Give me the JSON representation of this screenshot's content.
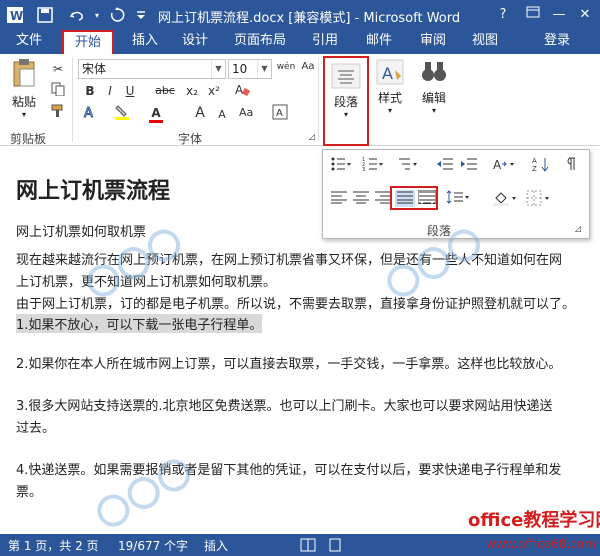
{
  "titlebar": {
    "title": "网上订机票流程.docx [兼容模式] - Microsoft Word",
    "help": "?",
    "minimize": "—",
    "maximize": "□",
    "close": "✕"
  },
  "quick_access": {
    "save": "save-icon",
    "undo": "undo-icon",
    "redo": "redo-icon",
    "customize": "customize-icon"
  },
  "tabs": [
    "文件",
    "开始",
    "插入",
    "设计",
    "页面布局",
    "引用",
    "邮件",
    "审阅",
    "视图"
  ],
  "login": "登录",
  "ribbon": {
    "clipboard": {
      "paste": "粘贴",
      "label": "剪贴板"
    },
    "font": {
      "name": "宋体",
      "size": "10",
      "label": "字体",
      "bold": "B",
      "italic": "I",
      "underline": "U",
      "strike": "abc",
      "sub": "x₂",
      "sup": "x²",
      "font_color": "A",
      "grow": "A",
      "shrink": "A",
      "wen": "wén",
      "aa": "Aa"
    },
    "paragraph": {
      "label": "段落"
    },
    "styles": {
      "label": "样式"
    },
    "editing": {
      "label": "编辑"
    }
  },
  "document": {
    "title": "网上订机票流程",
    "subtitle": "网上订机票如何取机票",
    "lines": [
      "现在越来越流行在网上预订机票，在网上预订机票省事又环保，但是还有一些人不知道如何在网",
      "上订机票，更不知道网上订机票如何取机票。",
      "由于网上订机票，订的都是电子机票。所以说，不需要去取票，直接拿身份证护照登机就可以了。",
      "1.如果不放心，可以下载一张电子行程单。",
      "2.如果你在本人所在城市网上订票，可以直接去取票，一手交钱，一手拿票。这样也比较放心。",
      "3.很多大网站支持送票的.北京地区免费送票。也可以上门刷卡。大家也可以要求网站用快递送",
      "过去。",
      "4.快递送票。如果需要报销或者是留下其他的凭证，可以在支付以后，要求快递电子行程单和发",
      "票。"
    ]
  },
  "popup": {
    "label": "段落"
  },
  "status": {
    "page": "第 1 页，共 2 页",
    "words": "19/677 个字",
    "mode": "插入"
  },
  "brand": {
    "text": "office教程学习网",
    "url": "www.office68.com"
  },
  "colors": {
    "accent": "#2b579a",
    "highlight_red": "#d21e1e"
  }
}
